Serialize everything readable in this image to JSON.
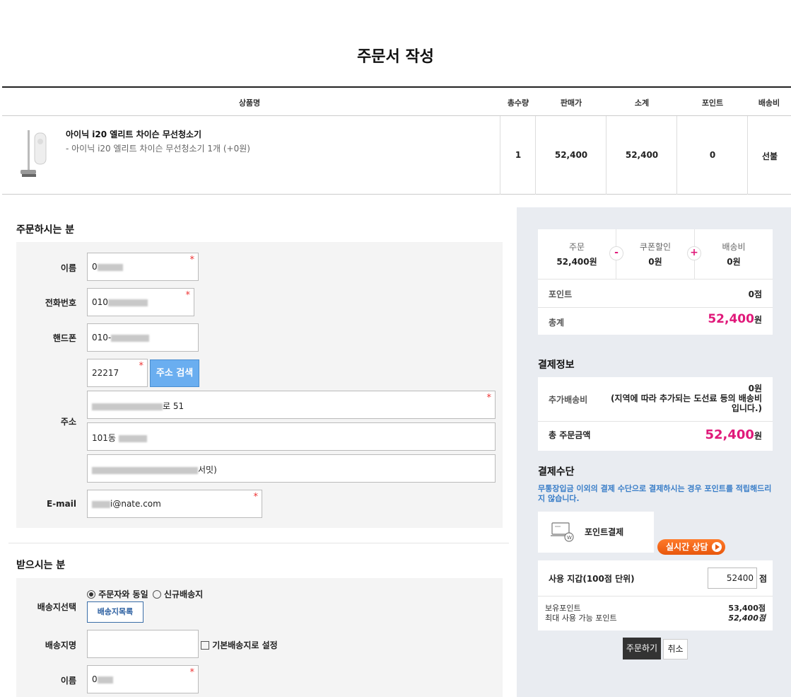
{
  "page_title": "주문서 작성",
  "product_table": {
    "headers": {
      "name": "상품명",
      "qty": "총수량",
      "price": "판매가",
      "subtotal": "소계",
      "point": "포인트",
      "shipping": "배송비"
    },
    "row": {
      "name": "아이닉 i20 엘리트 차이슨 무선청소기",
      "option": "- 아이닉 i20 엘리트 차이슨 무선청소기 1개 (+0원)",
      "qty": "1",
      "price": "52,400",
      "subtotal": "52,400",
      "point": "0",
      "shipping": "선불"
    }
  },
  "orderer": {
    "section_title": "주문하시는 분",
    "labels": {
      "name": "이름",
      "phone": "전화번호",
      "mobile": "핸드폰",
      "address": "주소",
      "email": "E-mail"
    },
    "name_prefix": "0",
    "phone_prefix": "010",
    "mobile_prefix": "010-",
    "zipcode": "22217",
    "address_search_button": "주소 검색",
    "address1_suffix": "로 51",
    "address2_prefix": "101동",
    "address3_suffix": "서밋)",
    "email_suffix": "i@nate.com",
    "required_mark": "*"
  },
  "receiver": {
    "section_title": "받으시는 분",
    "labels": {
      "ship_select": "배송지선택",
      "ship_name": "배송지명",
      "name": "이름"
    },
    "radio_same": "주문자와 동일",
    "radio_new": "신규배송지",
    "ship_list_button": "배송지목록",
    "default_checkbox": "기본배송지로 설정",
    "name_prefix": "0"
  },
  "summary": {
    "order_label": "주문",
    "order_value": "52,400원",
    "coupon_label": "쿠폰할인",
    "coupon_value": "0원",
    "shipping_label": "배송비",
    "shipping_value": "0원",
    "minus": "-",
    "plus": "+",
    "point_label": "포인트",
    "point_value": "0점",
    "total_label": "총계",
    "total_value": "52,400",
    "total_unit": "원"
  },
  "payment_info": {
    "title": "결제정보",
    "extra_ship_label": "추가배송비",
    "extra_ship_value": "0원",
    "extra_ship_note": "(지역에 따라 추가되는 도선료 등의 배송비입니다.)",
    "total_label": "총 주문금액",
    "total_value": "52,400",
    "total_unit": "원"
  },
  "payment_method": {
    "title": "결제수단",
    "notice": "무통장입금 이외의 결제 수단으로 결제하시는 경우 포인트를 적립해드리지 않습니다.",
    "point_pay_label": "포인트결제",
    "chat_button": "실시간 상담",
    "use_label": "사용 지갑(100점 단위)",
    "use_value": "52400",
    "use_unit": "점",
    "held_label": "보유포인트",
    "held_value": "53,400점",
    "max_label": "최대 사용 가능 포인트",
    "max_value": "52,400점"
  },
  "actions": {
    "order": "주문하기",
    "cancel": "취소"
  },
  "colors": {
    "accent_pink": "#e0197a",
    "button_blue": "#6aaef0",
    "notice_blue": "#3a7ec8"
  }
}
